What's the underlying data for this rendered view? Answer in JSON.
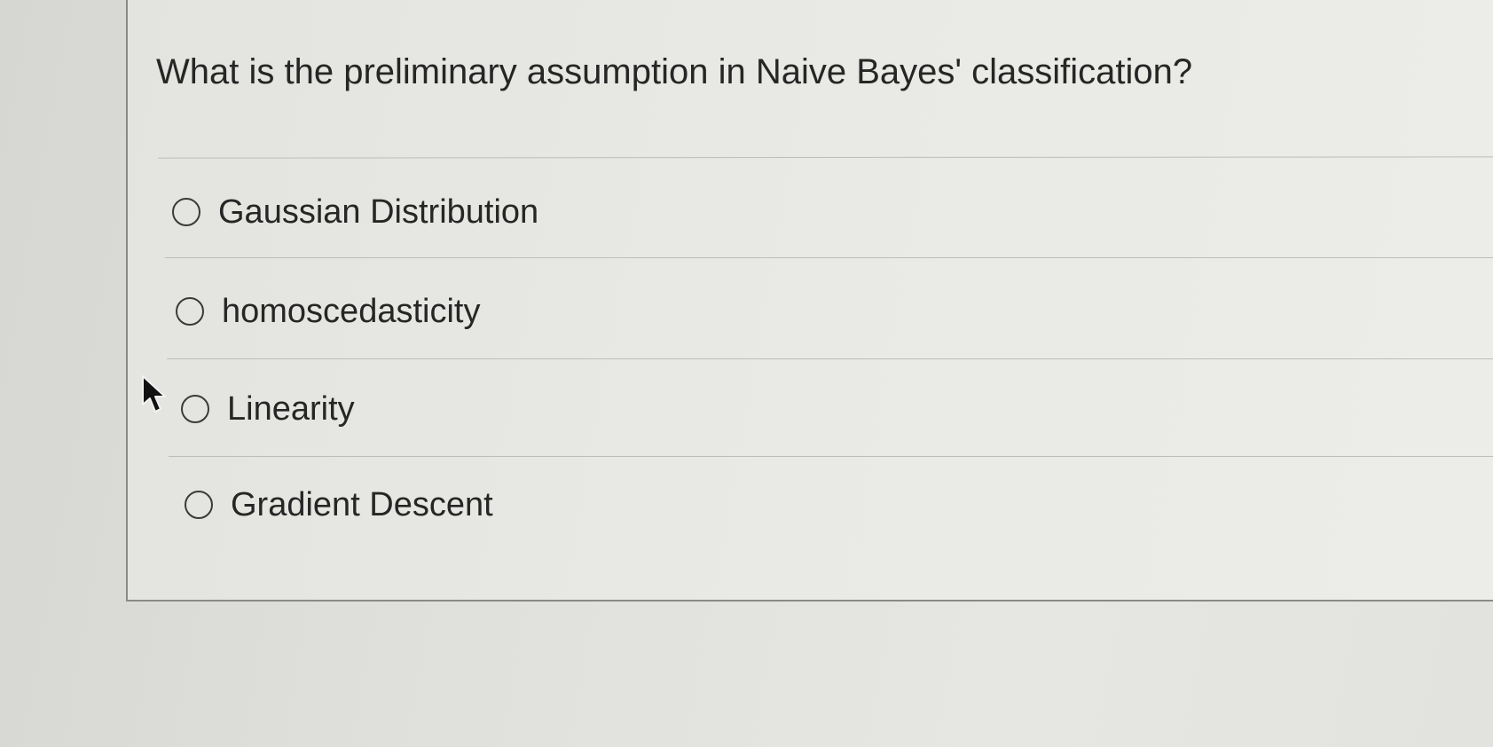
{
  "question": {
    "text": "What is the preliminary assumption in Naive Bayes' classification?"
  },
  "options": [
    {
      "label": "Gaussian Distribution",
      "selected": false
    },
    {
      "label": "homoscedasticity",
      "selected": false
    },
    {
      "label": "Linearity",
      "selected": false
    },
    {
      "label": "Gradient Descent",
      "selected": false
    }
  ],
  "cursor": {
    "icon": "mouse-pointer-icon"
  },
  "colors": {
    "background": "#dcdcd8",
    "card": "#e9e9e5",
    "text": "#262626",
    "border": "#8a8a88",
    "divider": "#bdbdb9"
  }
}
